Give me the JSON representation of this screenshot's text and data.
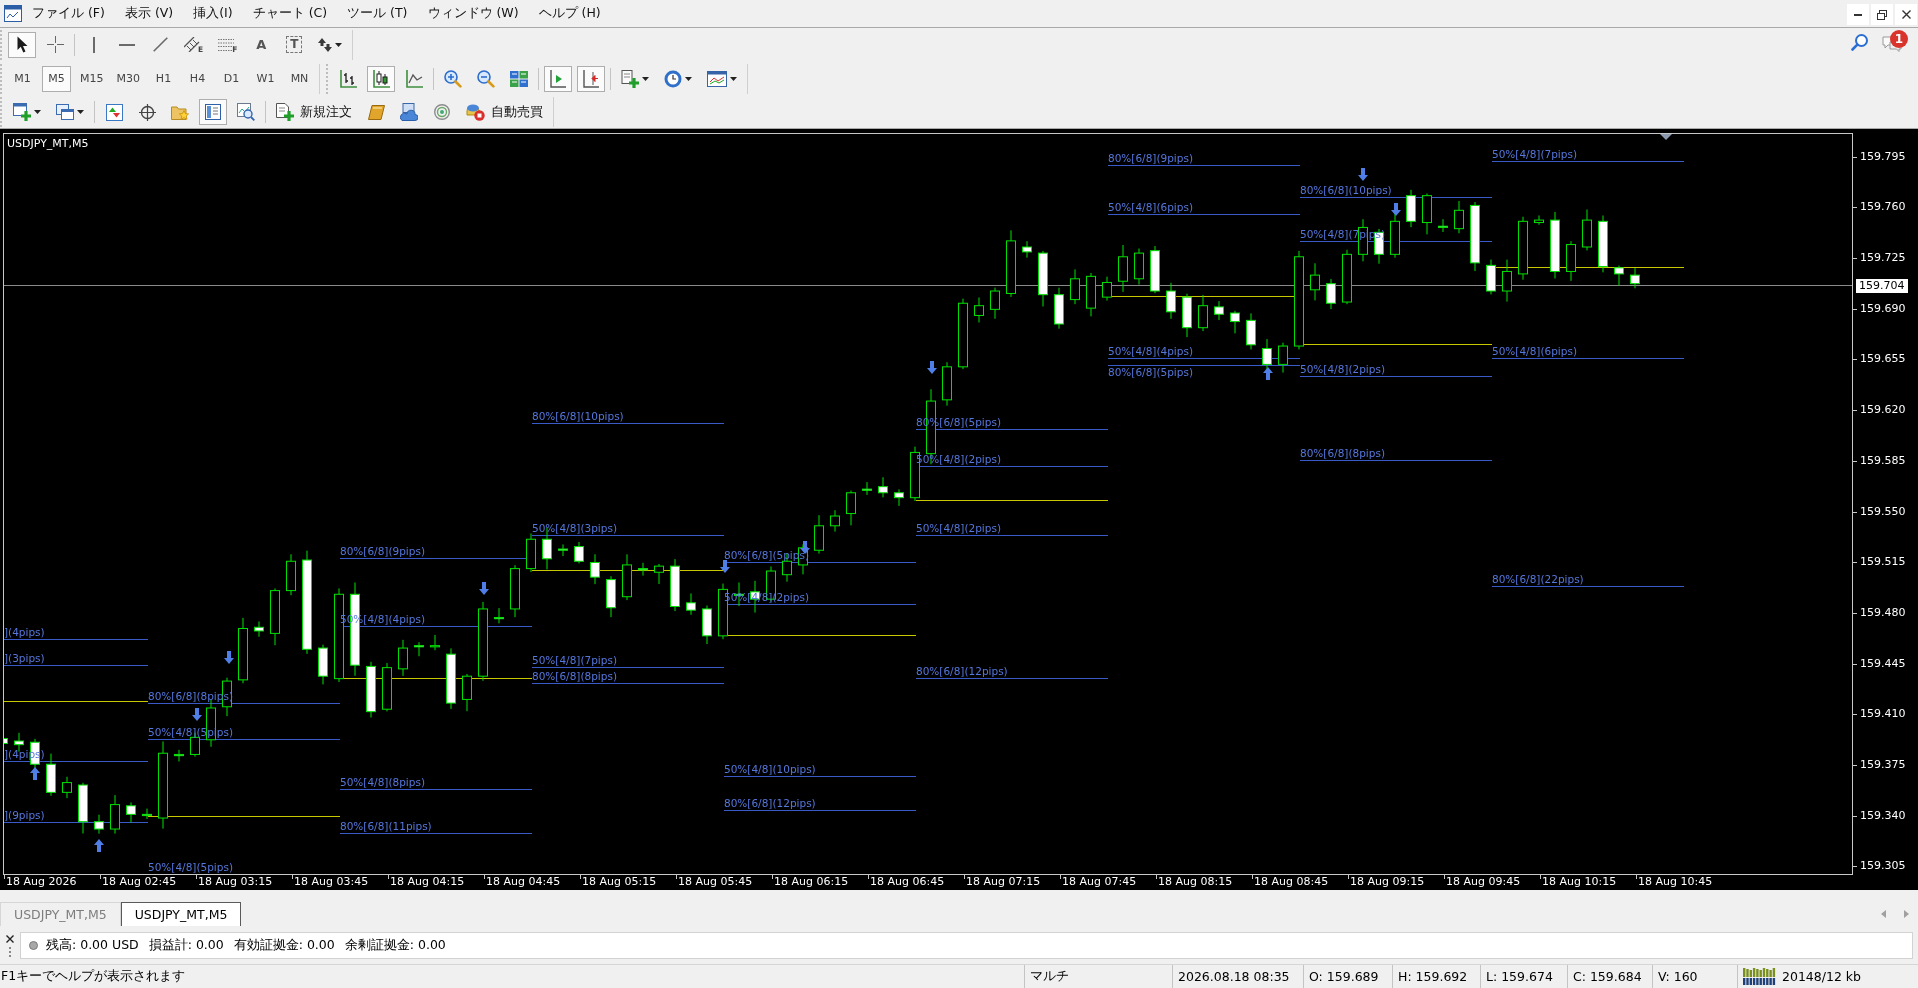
{
  "menu": [
    "ファイル (F)",
    "表示 (V)",
    "挿入(I)",
    "チャート (C)",
    "ツール (T)",
    "ウィンドウ (W)",
    "ヘルプ (H)"
  ],
  "toolbar_rows": [
    [
      {
        "groups": [
          [
            {
              "kind": "cursor",
              "selected": true
            },
            {
              "kind": "crosshair",
              "selected": false
            }
          ],
          [
            {
              "kind": "vertical-line",
              "selected": false
            },
            {
              "kind": "horizontal-line",
              "selected": false
            },
            {
              "kind": "trendline",
              "selected": false
            },
            {
              "kind": "channel",
              "selected": false,
              "tag": "E"
            },
            {
              "kind": "fibonacci",
              "selected": false,
              "tag": "F"
            },
            {
              "kind": "text",
              "selected": false,
              "glyph": "A"
            },
            {
              "kind": "text-label",
              "selected": false,
              "glyph": "T"
            },
            {
              "kind": "arrows",
              "selected": false,
              "menu": true
            }
          ]
        ]
      }
    ],
    [
      {
        "groups": [
          [
            {
              "kind": "timeframe",
              "label": "M1",
              "selected": false
            },
            {
              "kind": "timeframe",
              "label": "M5",
              "selected": true
            },
            {
              "kind": "timeframe",
              "label": "M15",
              "selected": false
            },
            {
              "kind": "timeframe",
              "label": "M30",
              "selected": false
            },
            {
              "kind": "timeframe",
              "label": "H1",
              "selected": false
            },
            {
              "kind": "timeframe",
              "label": "H4",
              "selected": false
            },
            {
              "kind": "timeframe",
              "label": "D1",
              "selected": false
            },
            {
              "kind": "timeframe",
              "label": "W1",
              "selected": false
            },
            {
              "kind": "timeframe",
              "label": "MN",
              "selected": false
            }
          ]
        ]
      },
      {
        "groups": [
          [
            {
              "kind": "bar-chart",
              "selected": false
            },
            {
              "kind": "candlestick",
              "selected": true
            },
            {
              "kind": "line-chart",
              "selected": false
            }
          ],
          [
            {
              "kind": "zoom-in",
              "selected": false
            },
            {
              "kind": "zoom-out",
              "selected": false
            },
            {
              "kind": "tile",
              "selected": false
            }
          ],
          [
            {
              "kind": "autoscroll",
              "selected": true
            },
            {
              "kind": "chart-shift",
              "selected": true
            }
          ],
          [
            {
              "kind": "indicators",
              "selected": false,
              "menu": true
            },
            {
              "kind": "periods",
              "selected": false,
              "menu": true
            },
            {
              "kind": "templates",
              "selected": false,
              "menu": true
            }
          ]
        ]
      }
    ],
    [
      {
        "groups": [
          [
            {
              "kind": "new-chart",
              "selected": false,
              "menu": true
            },
            {
              "kind": "profiles",
              "selected": false,
              "menu": true
            }
          ],
          [
            {
              "kind": "market-watch",
              "selected": false
            },
            {
              "kind": "navigator",
              "selected": false
            },
            {
              "kind": "favorites",
              "selected": false
            },
            {
              "kind": "terminal",
              "selected": true
            },
            {
              "kind": "tester",
              "selected": false
            }
          ],
          [
            {
              "kind": "new-order",
              "selected": false,
              "label": "新規注文"
            },
            {
              "kind": "editor",
              "selected": false
            },
            {
              "kind": "vps",
              "selected": false
            },
            {
              "kind": "signals",
              "selected": false
            },
            {
              "kind": "auto-trading",
              "selected": false,
              "label": "自動売買"
            }
          ]
        ]
      }
    ]
  ],
  "notifications": {
    "badge": "1"
  },
  "chart": {
    "title": "USDJPY_MT,M5",
    "level_labels": [
      "](4pips)",
      "](3pips)",
      "](4pips)",
      "](9pips)",
      "80%[6/8](8pips)",
      "50%[4/8](5pips)",
      "50%[4/8](5pips)",
      "80%[6/8](9pips)",
      "50%[4/8](4pips)",
      "50%[4/8](8pips)",
      "80%[6/8](11pips)",
      "80%[6/8](10pips)",
      "50%[4/8](3pips)",
      "50%[4/8](7pips)",
      "80%[6/8](8pips)",
      "80%[6/8](5pips)",
      "50%[4/8](2pips)",
      "50%[4/8](10pips)",
      "80%[6/8](12pips)",
      "80%[6/8](5pips)",
      "50%[4/8](2pips)",
      "50%[4/8](2pips)",
      "80%[6/8](12pips)",
      "80%[6/8](9pips)",
      "50%[4/8](6pips)",
      "50%[4/8](4pips)",
      "80%[6/8](5pips)",
      "80%[6/8](10pips)",
      "50%[4/8](7pips)",
      "50%[4/8](2pips)",
      "80%[6/8](8pips)",
      "50%[4/8](7pips)",
      "50%[4/8](6pips)",
      "80%[6/8](22pips)"
    ],
    "price_ticks": [
      "159.795",
      "159.760",
      "159.725",
      "159.690",
      "159.655",
      "159.620",
      "159.585",
      "159.550",
      "159.515",
      "159.480",
      "159.445",
      "159.410",
      "159.375",
      "159.340",
      "159.305"
    ],
    "current_price": "159.704",
    "time_ticks": [
      "18 Aug 2026",
      "18 Aug 02:45",
      "18 Aug 03:15",
      "18 Aug 03:45",
      "18 Aug 04:15",
      "18 Aug 04:45",
      "18 Aug 05:15",
      "18 Aug 05:45",
      "18 Aug 06:15",
      "18 Aug 06:45",
      "18 Aug 07:15",
      "18 Aug 07:45",
      "18 Aug 08:15",
      "18 Aug 08:45",
      "18 Aug 09:15",
      "18 Aug 09:45",
      "18 Aug 10:15",
      "18 Aug 10:45"
    ]
  },
  "chart_tabs": [
    {
      "label": "USDJPY_MT,M5",
      "selected": false
    },
    {
      "label": "USDJPY_MT,M5",
      "selected": true
    }
  ],
  "account_bar": {
    "items": [
      "残高: 0.00 USD",
      "損益計: 0.00",
      "有効証拠金: 0.00",
      "余剰証拠金: 0.00"
    ]
  },
  "status_bar": {
    "help": "F1キーでヘルプが表示されます",
    "cells": [
      "マルチ",
      "2026.08.18 08:35",
      "O: 159.689",
      "H: 159.692",
      "L: 159.674",
      "C: 159.684",
      "V: 160"
    ],
    "traffic": "20148/12 kb"
  }
}
